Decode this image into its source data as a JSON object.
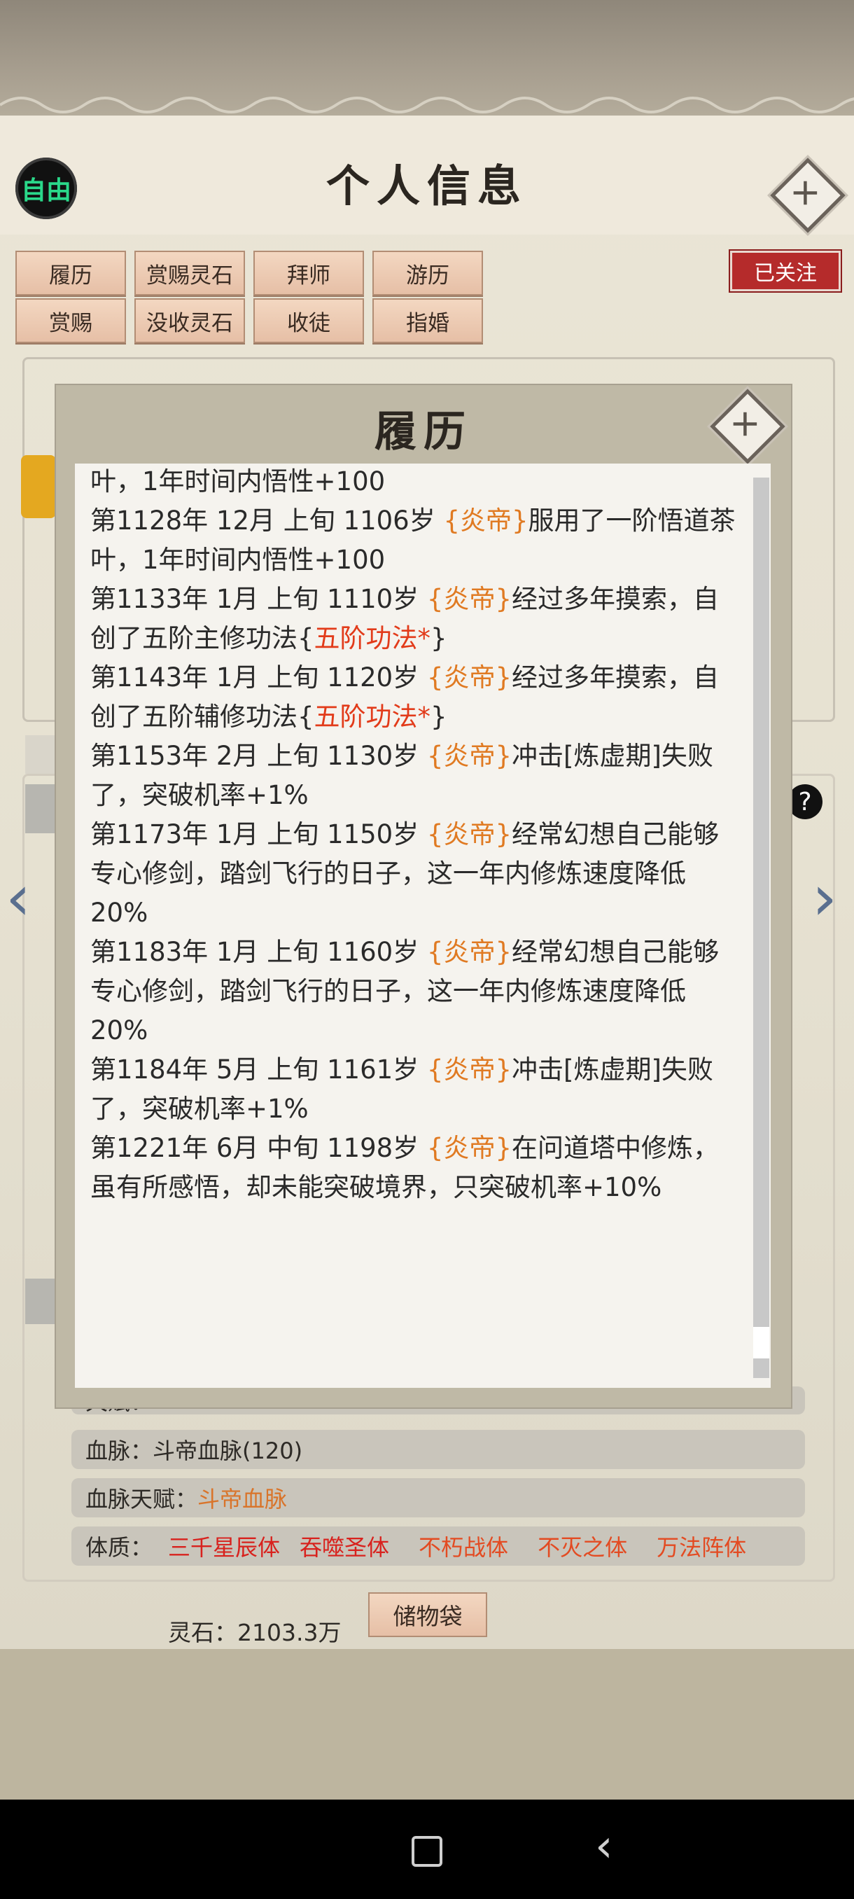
{
  "header": {
    "title": "个人信息",
    "mode_badge": "自由"
  },
  "actions": {
    "row1": [
      "履历",
      "赏赐灵石",
      "拜师",
      "游历"
    ],
    "row2": [
      "赏赐",
      "没收灵石",
      "收徒",
      "指婚"
    ],
    "followed": "已关注"
  },
  "details": {
    "talent_label": "天赋：",
    "bloodline_label": "血脉：",
    "bloodline_value": "斗帝血脉(120)",
    "bloodline_talent_label": "血脉天赋：",
    "bloodline_talent_value": "斗帝血脉",
    "physique_label": "体质：",
    "physiques": [
      "三千星辰体",
      "吞噬圣体",
      "不朽战体",
      "不灭之体",
      "万法阵体"
    ]
  },
  "footer": {
    "stone_label": "灵石：",
    "stone_value": "2103.3万",
    "bag_label": "储物袋"
  },
  "modal": {
    "title": "履历",
    "entries": [
      {
        "pre": "叶，1年时间内悟性+100",
        "name": "",
        "post": "",
        "skill": "",
        "tail": ""
      },
      {
        "pre": "第1128年 12月 上旬 1106岁 ",
        "name": "{炎帝}",
        "post": "服用了一阶悟道茶叶，1年时间内悟性+100",
        "skill": "",
        "tail": ""
      },
      {
        "pre": "第1133年 1月 上旬 1110岁 ",
        "name": "{炎帝}",
        "post": "经过多年摸索，自创了五阶主修功法{",
        "skill": "五阶功法*",
        "tail": "}"
      },
      {
        "pre": "第1143年 1月 上旬 1120岁 ",
        "name": "{炎帝}",
        "post": "经过多年摸索，自创了五阶辅修功法{",
        "skill": "五阶功法*",
        "tail": "}"
      },
      {
        "pre": "第1153年 2月 上旬  1130岁  ",
        "name": "{炎帝}",
        "post": "冲击[炼虚期]失败了，突破机率+1%",
        "skill": "",
        "tail": ""
      },
      {
        "pre": "第1173年 1月 上旬 1150岁 ",
        "name": "{炎帝}",
        "post": "经常幻想自己能够专心修剑，踏剑飞行的日子，这一年内修炼速度降低20%",
        "skill": "",
        "tail": ""
      },
      {
        "pre": "第1183年 1月 上旬 1160岁 ",
        "name": "{炎帝}",
        "post": "经常幻想自己能够专心修剑，踏剑飞行的日子，这一年内修炼速度降低20%",
        "skill": "",
        "tail": ""
      },
      {
        "pre": "第1184年 5月 上旬  1161岁  ",
        "name": "{炎帝}",
        "post": "冲击[炼虚期]失败了，突破机率+1%",
        "skill": "",
        "tail": ""
      },
      {
        "pre": "第1221年 6月 中旬 1198岁 ",
        "name": "{炎帝}",
        "post": "在问道塔中修炼，虽有所感悟，却未能突破境界，只突破机率+10%",
        "skill": "",
        "tail": ""
      }
    ]
  },
  "colors": {
    "hero": "#e07a22",
    "skill": "#e23b1a",
    "followed": "#b52b2b",
    "mode_text": "#2ad88a"
  },
  "icons": [
    "close-icon",
    "modal-close-icon",
    "help-icon",
    "left-arrow-icon",
    "right-arrow-icon",
    "nav-home-icon",
    "nav-back-icon"
  ]
}
